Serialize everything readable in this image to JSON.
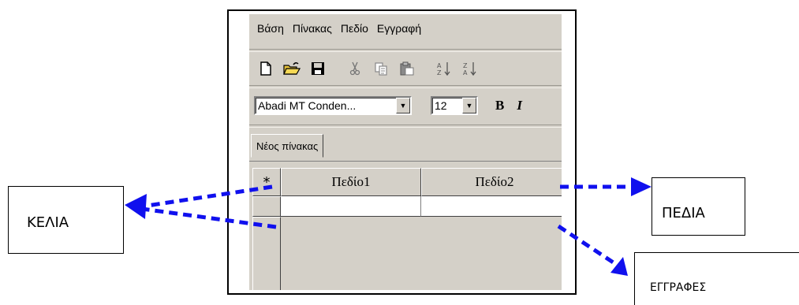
{
  "menu": [
    "Βάση",
    "Πίνακας",
    "Πεδίο",
    "Εγγραφή"
  ],
  "toolbar": {
    "icons": [
      "new-document-icon",
      "open-folder-icon",
      "save-disk-icon",
      "cut-icon",
      "copy-icon",
      "paste-icon",
      "sort-ascending-icon",
      "sort-descending-icon"
    ],
    "sort_asc_label": "A Z",
    "sort_desc_label": "Z A"
  },
  "format": {
    "font_name": "Abadi MT Conden...",
    "font_size": "12",
    "bold_label": "B",
    "italic_label": "I"
  },
  "tab": {
    "label": "Νέος πίνακας"
  },
  "grid": {
    "selector_symbol": "*",
    "columns": [
      "Πεδίο1",
      "Πεδίο2"
    ]
  },
  "callouts": {
    "cells": "ΚΕΛΙΑ",
    "fields": "ΠΕΔΙΑ",
    "records": "ΕΓΓΡΑΦΕΣ"
  },
  "colors": {
    "window_bg": "#d4d0c8",
    "arrow": "#1010ee"
  }
}
